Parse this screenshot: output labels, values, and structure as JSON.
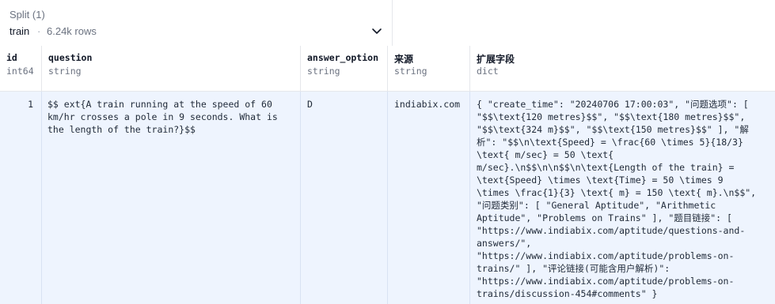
{
  "split": {
    "label": "Split (1)",
    "name": "train",
    "separator": "·",
    "rows": "6.24k rows",
    "dropdown_icon": "chevron-down-icon"
  },
  "columns": [
    {
      "name": "id",
      "type": "int64"
    },
    {
      "name": "question",
      "type": "string"
    },
    {
      "name": "answer_option",
      "type": "string"
    },
    {
      "name": "来源",
      "type": "string"
    },
    {
      "name": "扩展字段",
      "type": "dict"
    }
  ],
  "rows": [
    {
      "id": "1",
      "question": "$$ ext{A train running at the speed of 60\nkm/hr crosses a pole in 9 seconds. What is\nthe length of the train?}$$",
      "answer_option": "D",
      "source": "indiabix.com",
      "extra": "{ \"create_time\": \"20240706 17:00:03\", \"问题选项\": [\n\"$$\\text{120 metres}$$\", \"$$\\text{180 metres}$$\",\n\"$$\\text{324 m}$$\", \"$$\\text{150 metres}$$\" ], \"解\n析\": \"$$\\n\\text{Speed} = \\frac{60 \\times 5}{18/3}\n\\text{ m/sec} = 50 \\text{\nm/sec}.\\n$$\\n\\n$$\\n\\text{Length of the train} =\n\\text{Speed} \\times \\text{Time} = 50 \\times 9\n\\times \\frac{1}{3} \\text{ m} = 150 \\text{ m}.\\n$$\",\n\"问题类别\": [ \"General Aptitude\", \"Arithmetic\nAptitude\", \"Problems on Trains\" ], \"题目链接\": [\n\"https://www.indiabix.com/aptitude/questions-and-\nanswers/\",\n\"https://www.indiabix.com/aptitude/problems-on-\ntrains/\" ], \"评论链接(可能含用户解析)\":\n\"https://www.indiabix.com/aptitude/problems-on-\ntrains/discussion-454#comments\" }"
    }
  ]
}
